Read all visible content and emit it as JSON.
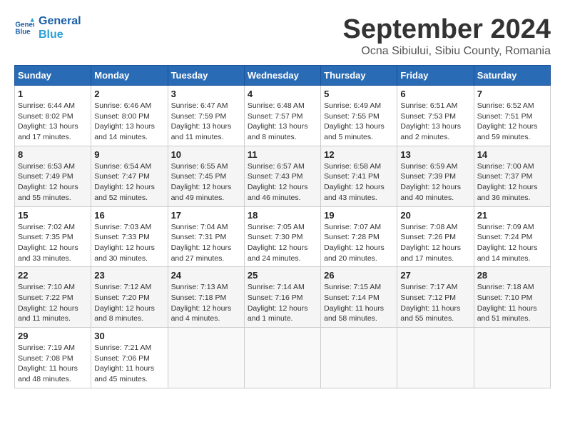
{
  "logo": {
    "line1": "General",
    "line2": "Blue"
  },
  "title": "September 2024",
  "location": "Ocna Sibiului, Sibiu County, Romania",
  "days_of_week": [
    "Sunday",
    "Monday",
    "Tuesday",
    "Wednesday",
    "Thursday",
    "Friday",
    "Saturday"
  ],
  "weeks": [
    [
      {
        "day": "1",
        "info": "Sunrise: 6:44 AM\nSunset: 8:02 PM\nDaylight: 13 hours\nand 17 minutes."
      },
      {
        "day": "2",
        "info": "Sunrise: 6:46 AM\nSunset: 8:00 PM\nDaylight: 13 hours\nand 14 minutes."
      },
      {
        "day": "3",
        "info": "Sunrise: 6:47 AM\nSunset: 7:59 PM\nDaylight: 13 hours\nand 11 minutes."
      },
      {
        "day": "4",
        "info": "Sunrise: 6:48 AM\nSunset: 7:57 PM\nDaylight: 13 hours\nand 8 minutes."
      },
      {
        "day": "5",
        "info": "Sunrise: 6:49 AM\nSunset: 7:55 PM\nDaylight: 13 hours\nand 5 minutes."
      },
      {
        "day": "6",
        "info": "Sunrise: 6:51 AM\nSunset: 7:53 PM\nDaylight: 13 hours\nand 2 minutes."
      },
      {
        "day": "7",
        "info": "Sunrise: 6:52 AM\nSunset: 7:51 PM\nDaylight: 12 hours\nand 59 minutes."
      }
    ],
    [
      {
        "day": "8",
        "info": "Sunrise: 6:53 AM\nSunset: 7:49 PM\nDaylight: 12 hours\nand 55 minutes."
      },
      {
        "day": "9",
        "info": "Sunrise: 6:54 AM\nSunset: 7:47 PM\nDaylight: 12 hours\nand 52 minutes."
      },
      {
        "day": "10",
        "info": "Sunrise: 6:55 AM\nSunset: 7:45 PM\nDaylight: 12 hours\nand 49 minutes."
      },
      {
        "day": "11",
        "info": "Sunrise: 6:57 AM\nSunset: 7:43 PM\nDaylight: 12 hours\nand 46 minutes."
      },
      {
        "day": "12",
        "info": "Sunrise: 6:58 AM\nSunset: 7:41 PM\nDaylight: 12 hours\nand 43 minutes."
      },
      {
        "day": "13",
        "info": "Sunrise: 6:59 AM\nSunset: 7:39 PM\nDaylight: 12 hours\nand 40 minutes."
      },
      {
        "day": "14",
        "info": "Sunrise: 7:00 AM\nSunset: 7:37 PM\nDaylight: 12 hours\nand 36 minutes."
      }
    ],
    [
      {
        "day": "15",
        "info": "Sunrise: 7:02 AM\nSunset: 7:35 PM\nDaylight: 12 hours\nand 33 minutes."
      },
      {
        "day": "16",
        "info": "Sunrise: 7:03 AM\nSunset: 7:33 PM\nDaylight: 12 hours\nand 30 minutes."
      },
      {
        "day": "17",
        "info": "Sunrise: 7:04 AM\nSunset: 7:31 PM\nDaylight: 12 hours\nand 27 minutes."
      },
      {
        "day": "18",
        "info": "Sunrise: 7:05 AM\nSunset: 7:30 PM\nDaylight: 12 hours\nand 24 minutes."
      },
      {
        "day": "19",
        "info": "Sunrise: 7:07 AM\nSunset: 7:28 PM\nDaylight: 12 hours\nand 20 minutes."
      },
      {
        "day": "20",
        "info": "Sunrise: 7:08 AM\nSunset: 7:26 PM\nDaylight: 12 hours\nand 17 minutes."
      },
      {
        "day": "21",
        "info": "Sunrise: 7:09 AM\nSunset: 7:24 PM\nDaylight: 12 hours\nand 14 minutes."
      }
    ],
    [
      {
        "day": "22",
        "info": "Sunrise: 7:10 AM\nSunset: 7:22 PM\nDaylight: 12 hours\nand 11 minutes."
      },
      {
        "day": "23",
        "info": "Sunrise: 7:12 AM\nSunset: 7:20 PM\nDaylight: 12 hours\nand 8 minutes."
      },
      {
        "day": "24",
        "info": "Sunrise: 7:13 AM\nSunset: 7:18 PM\nDaylight: 12 hours\nand 4 minutes."
      },
      {
        "day": "25",
        "info": "Sunrise: 7:14 AM\nSunset: 7:16 PM\nDaylight: 12 hours\nand 1 minute."
      },
      {
        "day": "26",
        "info": "Sunrise: 7:15 AM\nSunset: 7:14 PM\nDaylight: 11 hours\nand 58 minutes."
      },
      {
        "day": "27",
        "info": "Sunrise: 7:17 AM\nSunset: 7:12 PM\nDaylight: 11 hours\nand 55 minutes."
      },
      {
        "day": "28",
        "info": "Sunrise: 7:18 AM\nSunset: 7:10 PM\nDaylight: 11 hours\nand 51 minutes."
      }
    ],
    [
      {
        "day": "29",
        "info": "Sunrise: 7:19 AM\nSunset: 7:08 PM\nDaylight: 11 hours\nand 48 minutes."
      },
      {
        "day": "30",
        "info": "Sunrise: 7:21 AM\nSunset: 7:06 PM\nDaylight: 11 hours\nand 45 minutes."
      },
      {
        "day": "",
        "info": ""
      },
      {
        "day": "",
        "info": ""
      },
      {
        "day": "",
        "info": ""
      },
      {
        "day": "",
        "info": ""
      },
      {
        "day": "",
        "info": ""
      }
    ]
  ]
}
